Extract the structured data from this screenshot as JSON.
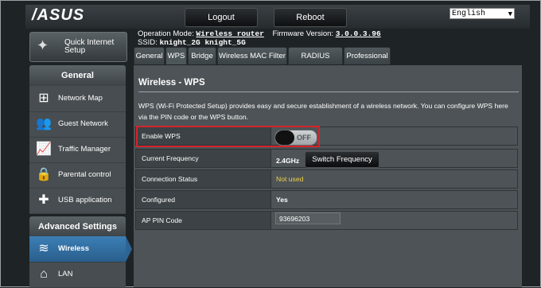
{
  "header": {
    "logo": "/ASUS",
    "logout_label": "Logout",
    "reboot_label": "Reboot",
    "language": "English"
  },
  "sidebar": {
    "quick_setup_label_1": "Quick Internet",
    "quick_setup_label_2": "Setup",
    "general_header": "General",
    "items": [
      {
        "label": "Network Map",
        "icon": "network-map-icon"
      },
      {
        "label": "Guest Network",
        "icon": "guest-network-icon"
      },
      {
        "label": "Traffic Manager",
        "icon": "traffic-manager-icon"
      },
      {
        "label": "Parental control",
        "icon": "parental-control-icon"
      },
      {
        "label": "USB application",
        "icon": "usb-application-icon"
      }
    ],
    "advanced_header": "Advanced Settings",
    "advanced_items": [
      {
        "label": "Wireless",
        "icon": "wifi-icon",
        "active": true
      },
      {
        "label": "LAN",
        "icon": "home-icon"
      }
    ]
  },
  "status": {
    "op_mode_label": "Operation Mode:",
    "op_mode_value": "Wireless router",
    "fw_label": "Firmware Version:",
    "fw_value": "3.0.0.3.96",
    "ssid_label": "SSID:",
    "ssid_value": "knight_2G knight_5G"
  },
  "tabs": [
    "General",
    "WPS",
    "Bridge",
    "Wireless MAC Filter",
    "RADIUS Setting",
    "Professional"
  ],
  "active_tab": "WPS",
  "page": {
    "title": "Wireless - WPS",
    "description": "WPS (Wi-Fi Protected Setup) provides easy and secure establishment of a wireless network. You can configure WPS here via the PIN code or the WPS button."
  },
  "settings": {
    "enable_wps_label": "Enable WPS",
    "enable_wps_value": "OFF",
    "current_frequency_label": "Current Frequency",
    "current_frequency_value": "2.4GHz",
    "switch_frequency_label": "Switch Frequency",
    "connection_status_label": "Connection Status",
    "connection_status_value": "Not used",
    "configured_label": "Configured",
    "configured_value": "Yes",
    "ap_pin_label": "AP PIN Code",
    "ap_pin_value": "93696203"
  },
  "colors": {
    "accent_blue": "#2d6494",
    "highlight_red": "#d4242b",
    "status_yellow": "#f2d04a"
  }
}
